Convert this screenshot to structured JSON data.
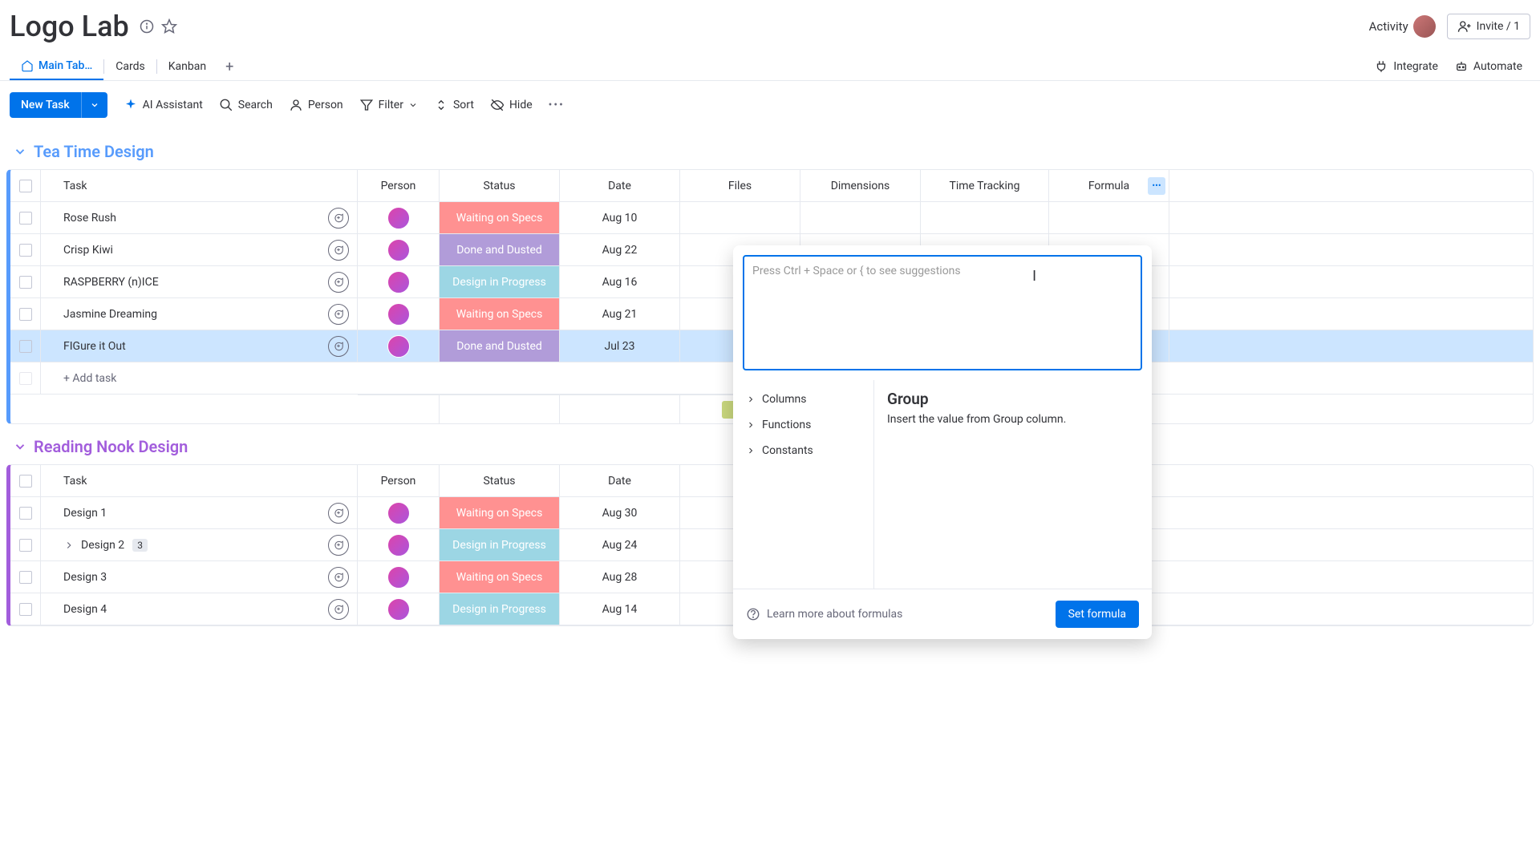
{
  "header": {
    "title": "Logo Lab",
    "activity_label": "Activity",
    "invite_label": "Invite / 1"
  },
  "tabs": {
    "items": [
      "Main Tab…",
      "Cards",
      "Kanban"
    ],
    "right": {
      "integrate": "Integrate",
      "automate": "Automate"
    }
  },
  "toolbar": {
    "new_task": "New Task",
    "ai": "AI Assistant",
    "search": "Search",
    "person": "Person",
    "filter": "Filter",
    "sort": "Sort",
    "hide": "Hide"
  },
  "columns": {
    "task": "Task",
    "person": "Person",
    "status": "Status",
    "date": "Date",
    "files": "Files",
    "dimensions": "Dimensions",
    "time": "Time Tracking",
    "formula": "Formula"
  },
  "groups": [
    {
      "name": "Tea Time Design",
      "color": "blue",
      "rows": [
        {
          "task": "Rose Rush",
          "status": "Waiting on Specs",
          "status_class": "st-waiting",
          "date": "Aug 10",
          "selected": false,
          "expand": false
        },
        {
          "task": "Crisp Kiwi",
          "status": "Done and Dusted",
          "status_class": "st-done",
          "date": "Aug 22",
          "selected": false,
          "expand": false
        },
        {
          "task": "RASPBERRY (n)ICE",
          "status": "Design in Progress",
          "status_class": "st-progress",
          "date": "Aug 16",
          "selected": false,
          "expand": false
        },
        {
          "task": "Jasmine Dreaming",
          "status": "Waiting on Specs",
          "status_class": "st-waiting",
          "date": "Aug 21",
          "selected": false,
          "expand": false
        },
        {
          "task": "FIGure it Out",
          "status": "Done and Dusted",
          "status_class": "st-done",
          "date": "Jul 23",
          "selected": true,
          "expand": false
        }
      ],
      "add_task": "+ Add task"
    },
    {
      "name": "Reading Nook Design",
      "color": "purple",
      "rows": [
        {
          "task": "Design 1",
          "status": "Waiting on Specs",
          "status_class": "st-waiting",
          "date": "Aug 30",
          "selected": false,
          "expand": false
        },
        {
          "task": "Design 2",
          "status": "Design in Progress",
          "status_class": "st-progress",
          "date": "Aug 24",
          "selected": false,
          "expand": true,
          "subcount": "3"
        },
        {
          "task": "Design 3",
          "status": "Waiting on Specs",
          "status_class": "st-waiting",
          "date": "Aug 28",
          "selected": false,
          "expand": false
        },
        {
          "task": "Design 4",
          "status": "Design in Progress",
          "status_class": "st-progress",
          "date": "Aug 14",
          "selected": false,
          "expand": false
        }
      ]
    }
  ],
  "formula_panel": {
    "placeholder": "Press Ctrl + Space or { to see suggestions",
    "sidebar": [
      "Columns",
      "Functions",
      "Constants"
    ],
    "detail_title": "Group",
    "detail_desc": "Insert the value from Group column.",
    "learn_more": "Learn more about formulas",
    "set_button": "Set formula"
  }
}
